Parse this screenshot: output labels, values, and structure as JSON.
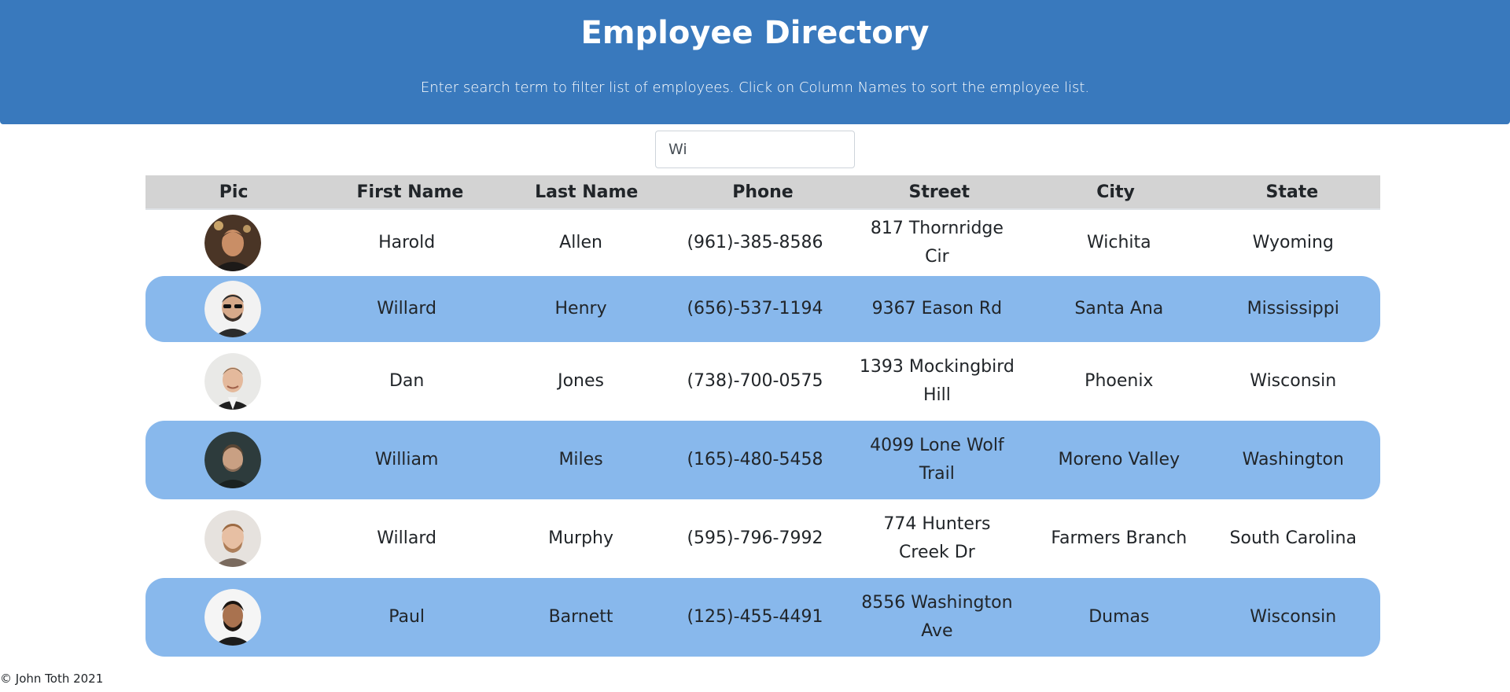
{
  "header": {
    "title": "Employee Directory",
    "subtitle": "Enter search term to filter list of employees. Click on Column Names to sort the employee list."
  },
  "search": {
    "value": "Wi"
  },
  "table": {
    "columns": [
      "Pic",
      "First Name",
      "Last Name",
      "Phone",
      "Street",
      "City",
      "State"
    ],
    "rows": [
      {
        "first": "Harold",
        "last": "Allen",
        "phone": "(961)-385-8586",
        "street": "817 Thornridge Cir",
        "city": "Wichita",
        "state": "Wyoming"
      },
      {
        "first": "Willard",
        "last": "Henry",
        "phone": "(656)-537-1194",
        "street": "9367 Eason Rd",
        "city": "Santa Ana",
        "state": "Mississippi"
      },
      {
        "first": "Dan",
        "last": "Jones",
        "phone": "(738)-700-0575",
        "street": "1393 Mockingbird Hill",
        "city": "Phoenix",
        "state": "Wisconsin"
      },
      {
        "first": "William",
        "last": "Miles",
        "phone": "(165)-480-5458",
        "street": "4099 Lone Wolf Trail",
        "city": "Moreno Valley",
        "state": "Washington"
      },
      {
        "first": "Willard",
        "last": "Murphy",
        "phone": "(595)-796-7992",
        "street": "774 Hunters Creek Dr",
        "city": "Farmers Branch",
        "state": "South Carolina"
      },
      {
        "first": "Paul",
        "last": "Barnett",
        "phone": "(125)-455-4491",
        "street": "8556 Washington Ave",
        "city": "Dumas",
        "state": "Wisconsin"
      }
    ]
  },
  "footer": {
    "text": "© John Toth 2021"
  },
  "colors": {
    "header_bg": "#3979bd",
    "alt_row_bg": "#88b8ec",
    "table_head_bg": "#d3d3d3"
  }
}
